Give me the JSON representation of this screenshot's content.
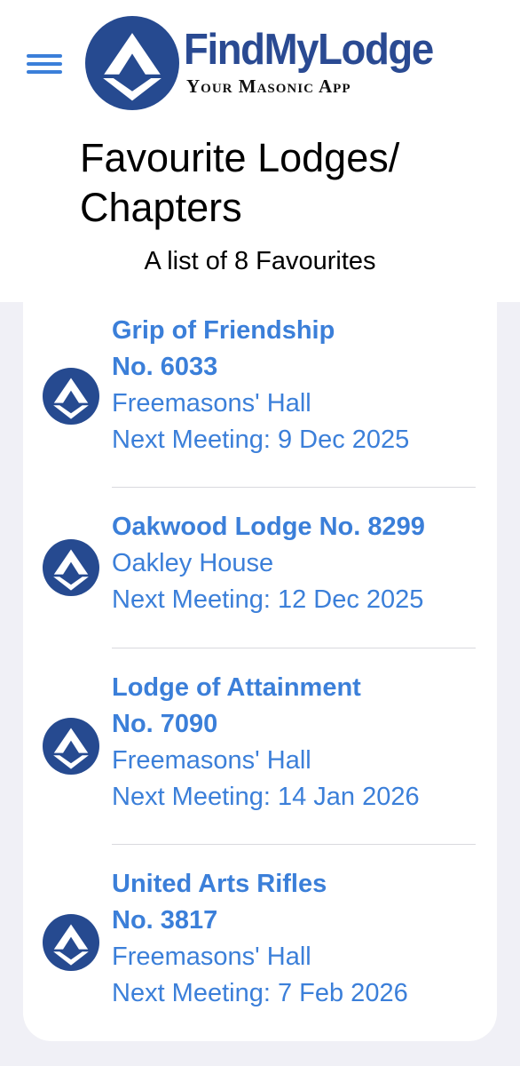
{
  "header": {
    "brand_name": "FindMyLodge",
    "brand_tagline": "Your Masonic App",
    "title": "Favourite Lodges/ Chapters",
    "subtitle": "A list of 8 Favourites"
  },
  "colors": {
    "accent": "#3b7fd9",
    "brand_navy": "#264a90",
    "divider": "#d9d9de",
    "background": "#f0f0f6"
  },
  "favourites": [
    {
      "title_line1": "Grip of Friendship",
      "title_line2": "No. 6033",
      "venue": "Freemasons' Hall",
      "next_meeting": "Next Meeting:  9 Dec 2025",
      "icon": "square-compass-icon"
    },
    {
      "title_line1": "Oakwood Lodge No. 8299",
      "venue": "Oakley House",
      "next_meeting": "Next Meeting:  12 Dec 2025",
      "icon": "square-compass-icon"
    },
    {
      "title_line1": "Lodge of Attainment",
      "title_line2": "No. 7090",
      "venue": "Freemasons' Hall",
      "next_meeting": "Next Meeting:  14 Jan 2026",
      "icon": "square-compass-icon"
    },
    {
      "title_line1": "United Arts Rifles",
      "title_line2": "No. 3817",
      "venue": "Freemasons' Hall",
      "next_meeting": "Next Meeting:  7 Feb 2026",
      "icon": "square-compass-icon"
    }
  ]
}
